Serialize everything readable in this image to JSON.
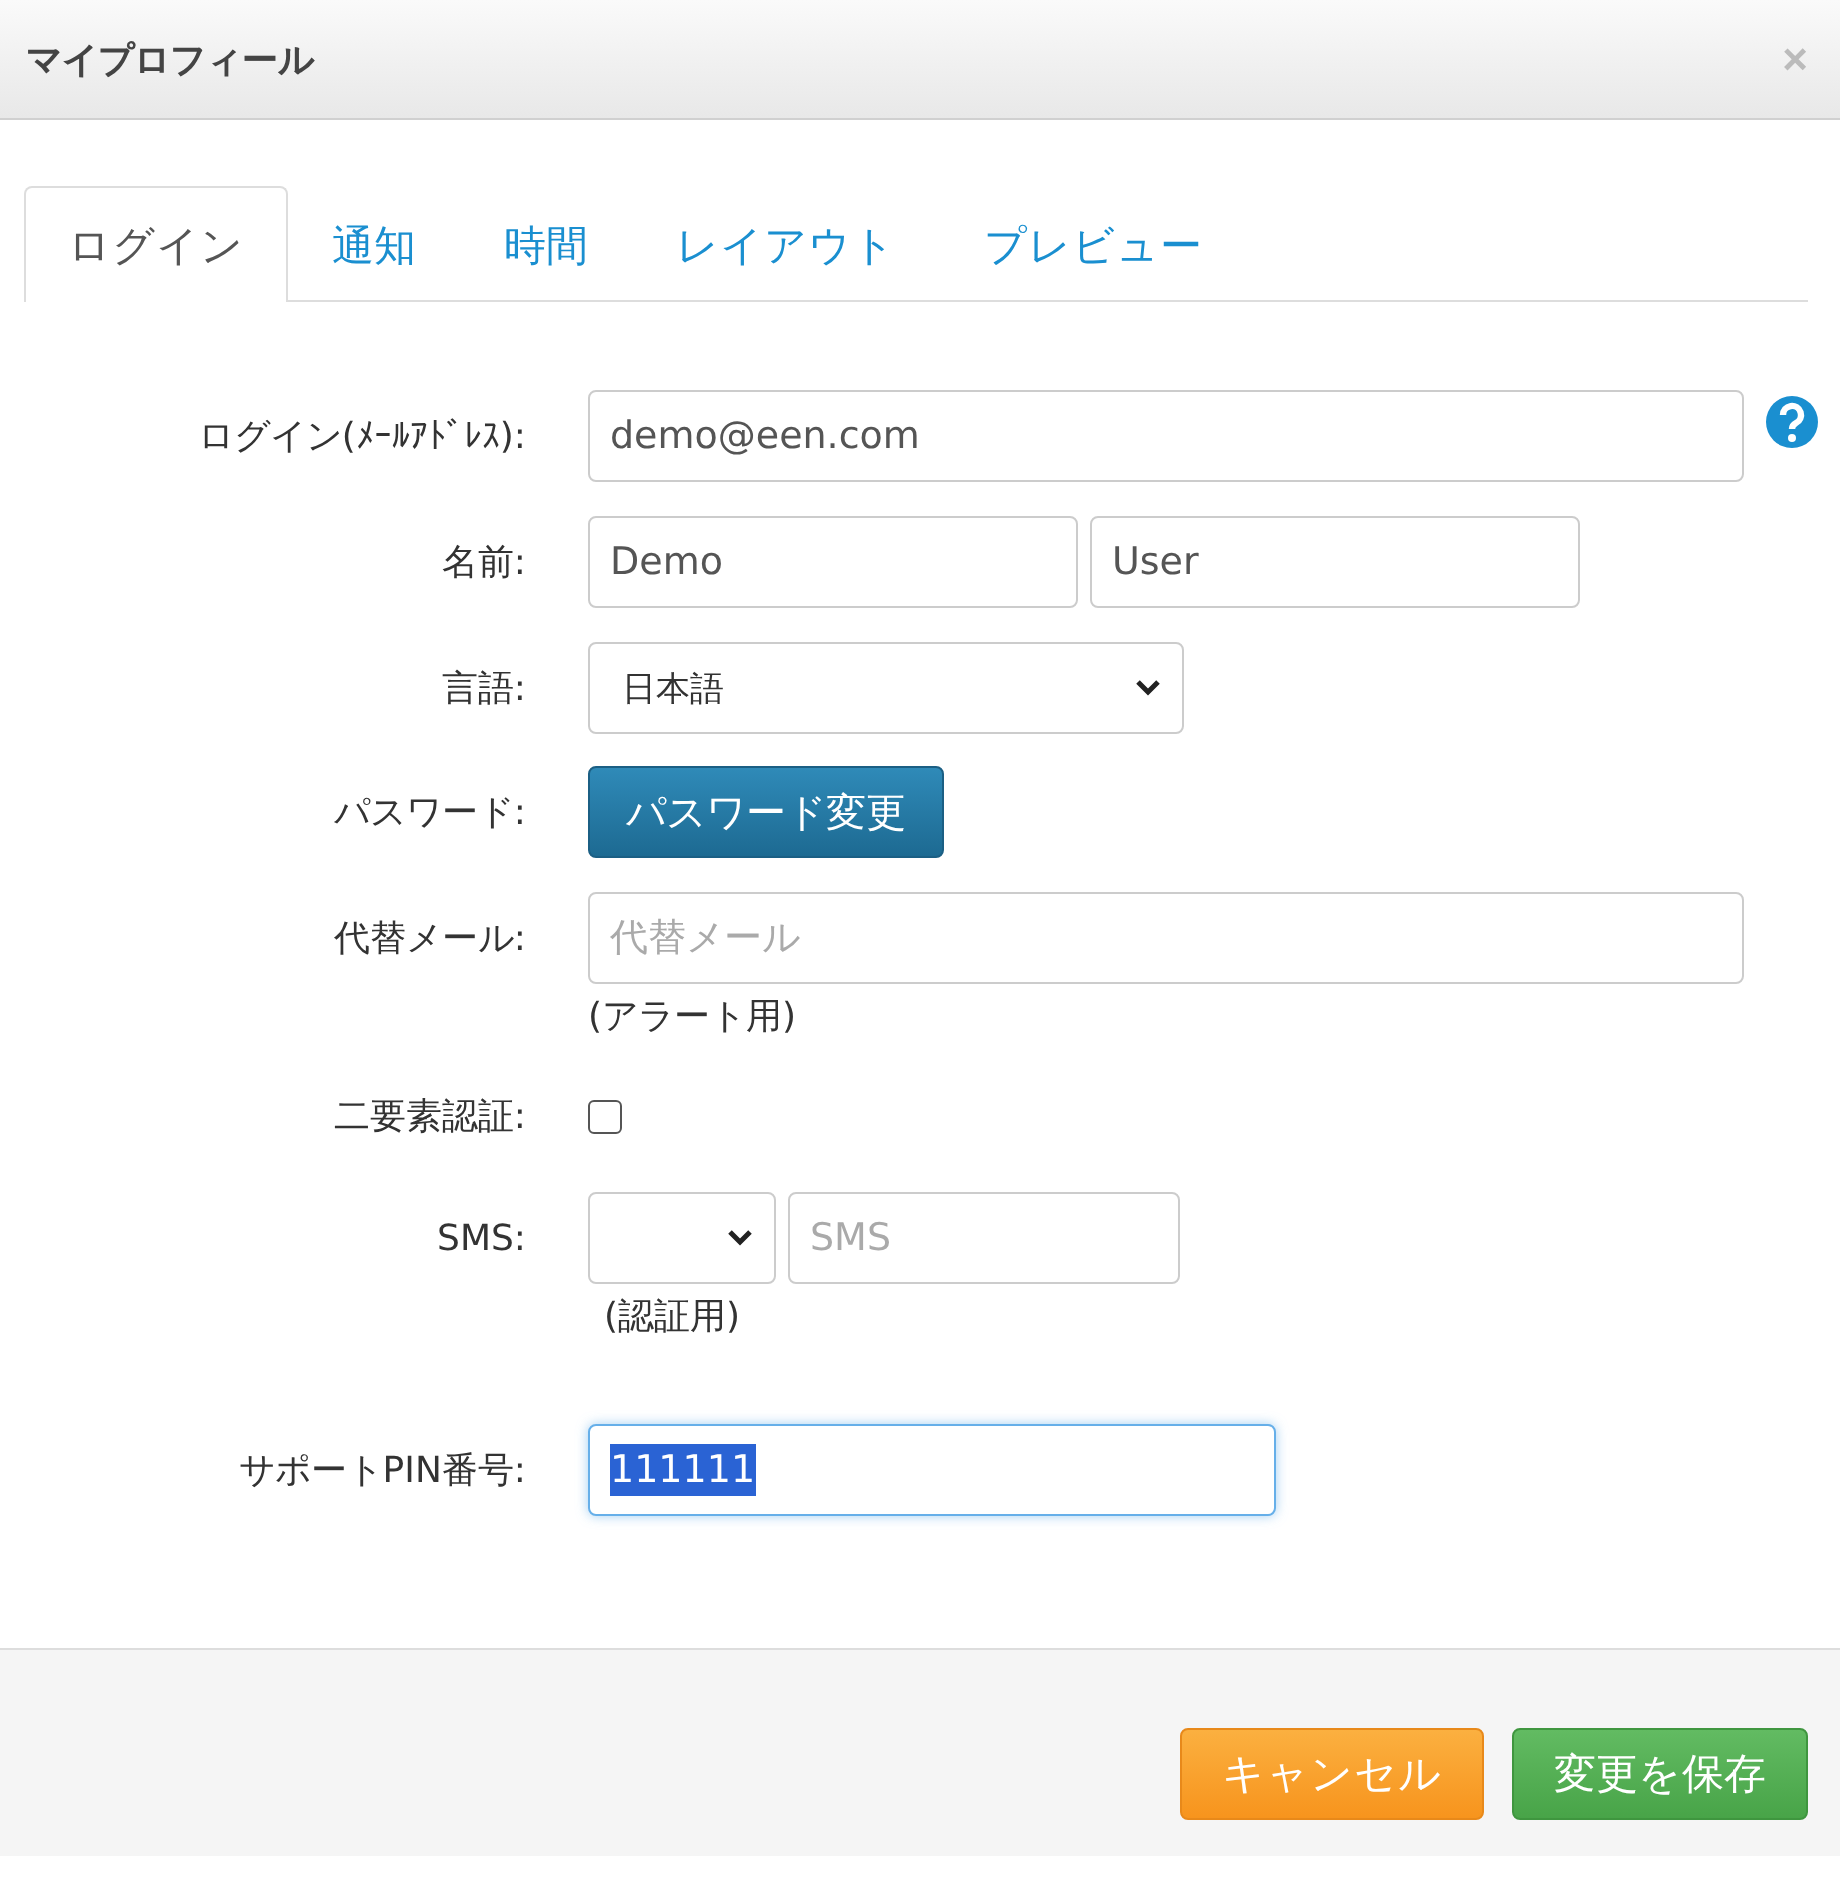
{
  "window": {
    "title": "マイプロフィール",
    "close": "×"
  },
  "tabs": [
    {
      "label": "ログイン",
      "selected": true
    },
    {
      "label": "通知",
      "selected": false
    },
    {
      "label": "時間",
      "selected": false
    },
    {
      "label": "レイアウト",
      "selected": false
    },
    {
      "label": "プレビュー",
      "selected": false
    }
  ],
  "form": {
    "login": {
      "label": "ログイン(ﾒｰﾙｱﾄﾞﾚｽ):",
      "value": "demo@een.com"
    },
    "name": {
      "label": "名前:",
      "first": "Demo",
      "last": "User"
    },
    "language": {
      "label": "言語:",
      "value": "日本語"
    },
    "password": {
      "label": "パスワード:",
      "button": "パスワード変更"
    },
    "alt_email": {
      "label": "代替メール:",
      "placeholder": "代替メール",
      "note": "(アラート用)"
    },
    "two_factor": {
      "label": "二要素認証:",
      "checked": false
    },
    "sms": {
      "label": "SMS:",
      "placeholder": "SMS",
      "note": "(認証用)"
    },
    "pin": {
      "label": "サポートPIN番号:",
      "value": "111111",
      "focused": true,
      "text_selected": true
    }
  },
  "buttons": [
    {
      "label": "キャンセル",
      "kind": "cancel"
    },
    {
      "label": "変更を保存",
      "kind": "save"
    }
  ]
}
